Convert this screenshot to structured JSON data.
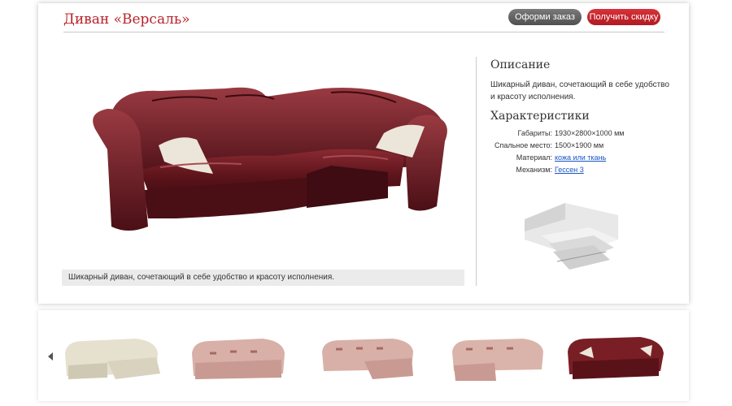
{
  "header": {
    "title": "Диван «Версаль»",
    "order_button": "Оформи заказ",
    "discount_button": "Получить скидку"
  },
  "main": {
    "caption": "Шикарный диван, сочетающий в себе удобство и красоту исполнения."
  },
  "sidebar": {
    "description_heading": "Описание",
    "description_text": "Шикарный диван, сочетающий в себе удобство и красоту исполнения.",
    "specs_heading": "Характеристики",
    "specs": [
      {
        "label": "Габариты:",
        "value": "1930×2800×1000 мм"
      },
      {
        "label": "Спальное место:",
        "value": "1500×1900 мм"
      },
      {
        "label": "Материал:",
        "value": "кожа или ткань"
      },
      {
        "label": "Механизм:",
        "value": "Гессен 3"
      }
    ]
  },
  "colors": {
    "brand_red": "#b8212a",
    "leather": "#6b1820",
    "link": "#1a55c8"
  }
}
